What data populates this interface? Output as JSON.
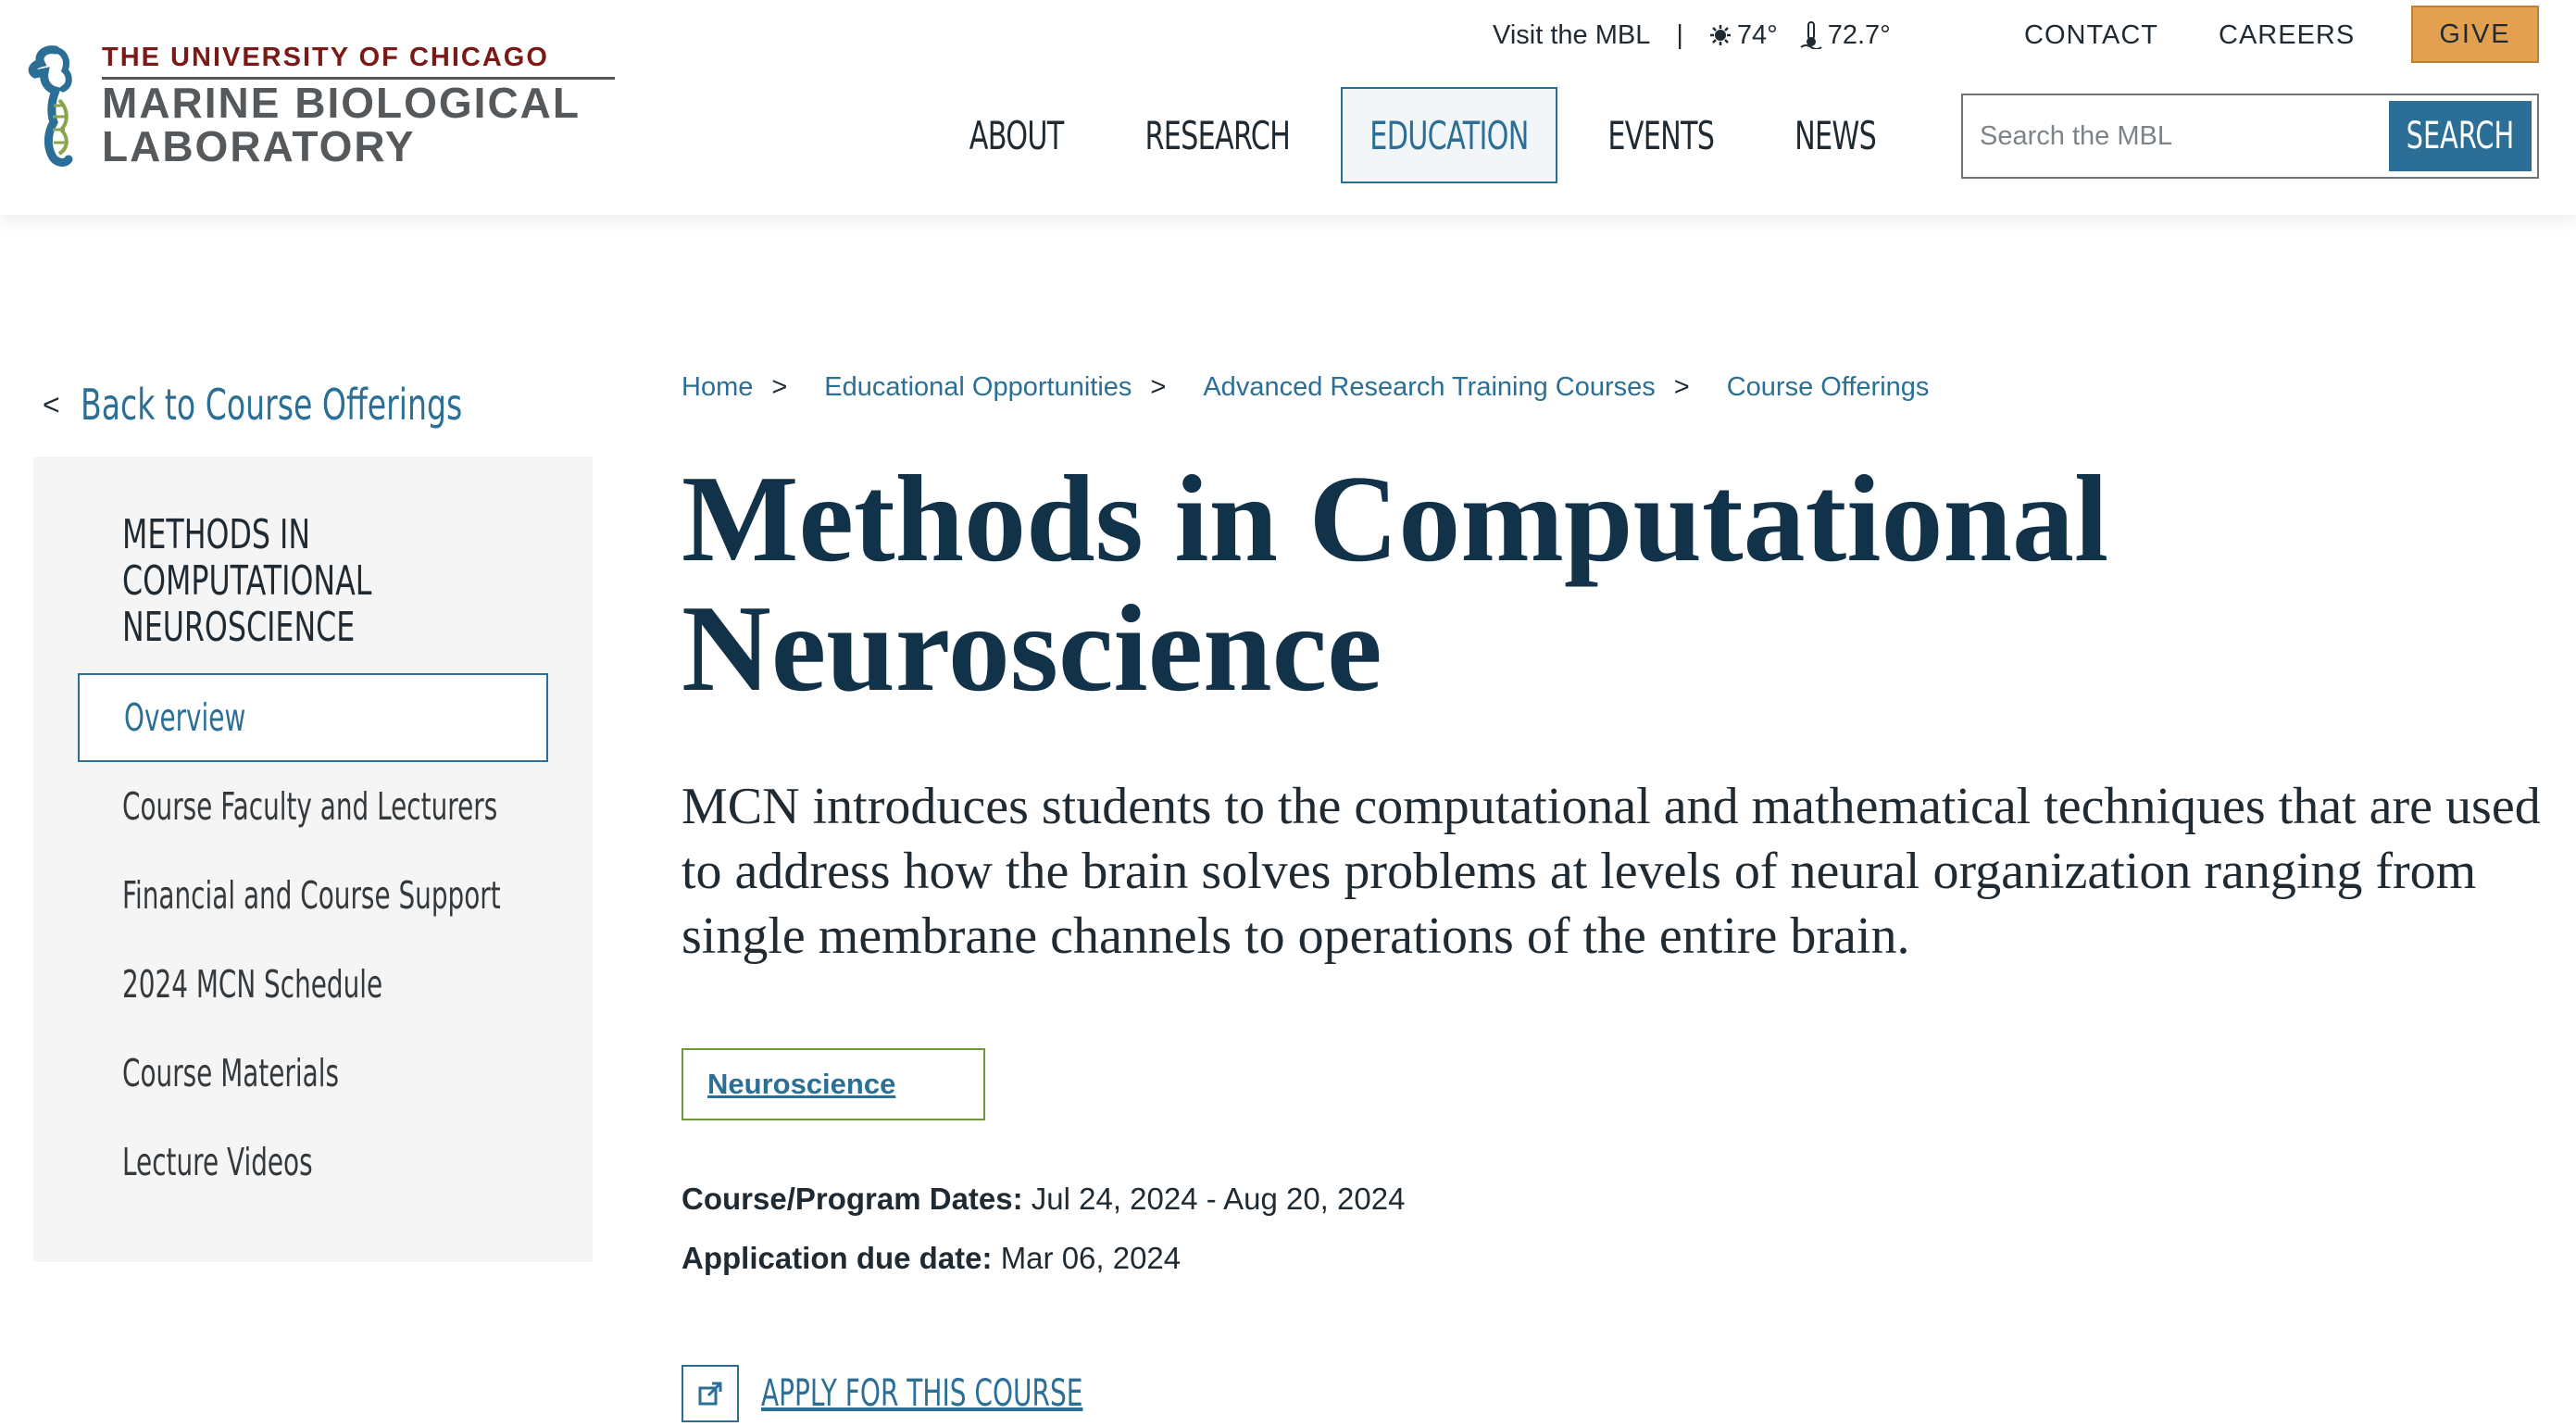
{
  "logo": {
    "top_line": "THE UNIVERSITY OF CHICAGO",
    "main_line1": "MARINE BIOLOGICAL",
    "main_line2": "LABORATORY",
    "seahorse_color": "#2b6f96",
    "accent_color": "#7a1a17"
  },
  "utility": {
    "visit": "Visit the MBL",
    "separator": "|",
    "air_temp": "74°",
    "water_temp": "72.7°",
    "contact": "CONTACT",
    "careers": "CAREERS",
    "give": "GIVE"
  },
  "nav": {
    "items": [
      {
        "label": "ABOUT"
      },
      {
        "label": "RESEARCH"
      },
      {
        "label": "EDUCATION",
        "active": true
      },
      {
        "label": "EVENTS"
      },
      {
        "label": "NEWS"
      }
    ]
  },
  "search": {
    "placeholder": "Search the MBL",
    "button": "SEARCH"
  },
  "sidebar": {
    "back_link": "Back to Course Offerings",
    "title_lines": [
      "METHODS IN",
      "COMPUTATIONAL",
      "NEUROSCIENCE"
    ],
    "items": [
      {
        "label": "Overview",
        "active": true
      },
      {
        "label": "Course Faculty and Lecturers"
      },
      {
        "label": "Financial and Course Support"
      },
      {
        "label": "2024 MCN Schedule"
      },
      {
        "label": "Course Materials"
      },
      {
        "label": "Lecture Videos"
      }
    ]
  },
  "breadcrumb": {
    "items": [
      "Home",
      "Educational Opportunities",
      "Advanced Research Training Courses",
      "Course Offerings"
    ],
    "separator": ">"
  },
  "main": {
    "title_line1": "Methods in Computational",
    "title_line2": "Neuroscience",
    "intro": "MCN introduces students to the computational and mathematical techniques that are used to address how the brain solves problems at levels of neural organization ranging from single membrane channels to operations of the entire brain.",
    "tag": "Neuroscience",
    "dates_label": "Course/Program Dates:",
    "dates_value": "Jul 24, 2024 - Aug 20, 2024",
    "due_label": "Application due date:",
    "due_value": "Mar 06, 2024",
    "apply": "APPLY FOR THIS COURSE"
  },
  "colors": {
    "link_blue": "#2b6f96",
    "title_navy": "#12324a",
    "give_orange": "#e3a050",
    "tag_green": "#6b9a3d",
    "panel_gray": "#f5f5f5"
  }
}
